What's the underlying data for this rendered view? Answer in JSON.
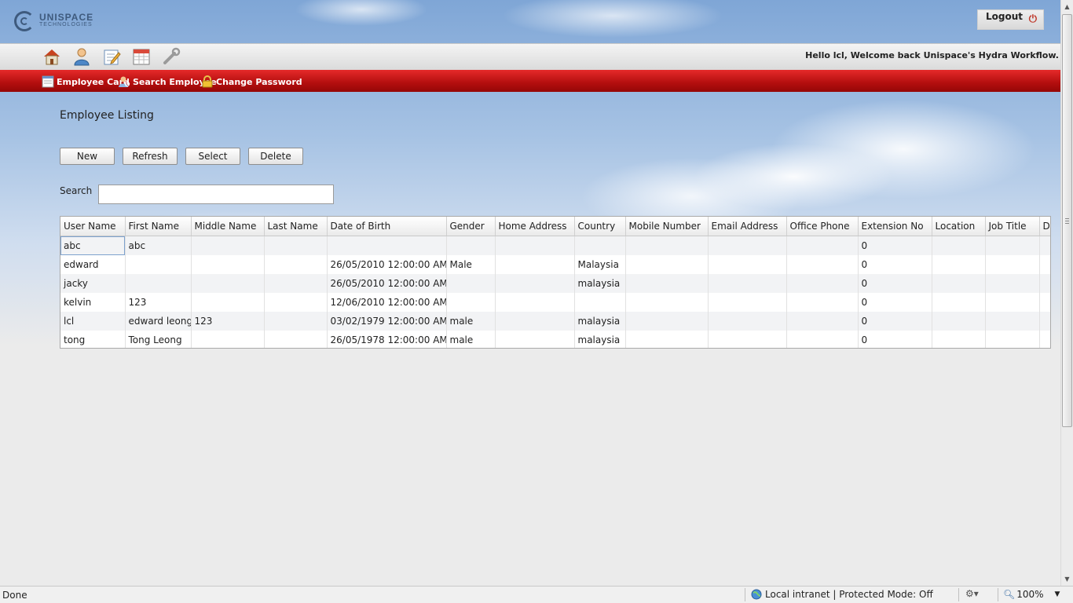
{
  "header": {
    "logo_line1": "UNISPACE",
    "logo_line2": "TECHNOLOGIES",
    "logout_label": "Logout",
    "welcome": "Hello lcl, Welcome back Unispace's Hydra Workflow."
  },
  "toolbar": {
    "icons": [
      "home-icon",
      "user-icon",
      "edit-icon",
      "calendar-icon",
      "tools-icon"
    ]
  },
  "menu": {
    "employee_card": "Employee Card",
    "search_employee": "Search Employee",
    "change_password": "Change Password"
  },
  "page": {
    "title": "Employee Listing",
    "buttons": {
      "new": "New",
      "refresh": "Refresh",
      "select": "Select",
      "delete": "Delete"
    },
    "search_label": "Search",
    "search_value": ""
  },
  "grid": {
    "columns": [
      "User Name",
      "First Name",
      "Middle Name",
      "Last Name",
      "Date of Birth",
      "Gender",
      "Home Address",
      "Country",
      "Mobile Number",
      "Email Address",
      "Office Phone",
      "Extension No",
      "Location",
      "Job Title",
      "De"
    ],
    "rows": [
      [
        "abc",
        "abc",
        "",
        "",
        "",
        "",
        "",
        "",
        "",
        "",
        "",
        "0",
        "",
        "",
        ""
      ],
      [
        "edward",
        "",
        "",
        "",
        "26/05/2010 12:00:00 AM",
        "Male",
        "",
        "Malaysia",
        "",
        "",
        "",
        "0",
        "",
        "",
        ""
      ],
      [
        "jacky",
        "",
        "",
        "",
        "26/05/2010 12:00:00 AM",
        "",
        "",
        "malaysia",
        "",
        "",
        "",
        "0",
        "",
        "",
        ""
      ],
      [
        "kelvin",
        "123",
        "",
        "",
        "12/06/2010 12:00:00 AM",
        "",
        "",
        "",
        "",
        "",
        "",
        "0",
        "",
        "",
        ""
      ],
      [
        "lcl",
        "edward leong",
        "123",
        "",
        "03/02/1979 12:00:00 AM",
        "male",
        "",
        "malaysia",
        "",
        "",
        "",
        "0",
        "",
        "",
        ""
      ],
      [
        "tong",
        "Tong Leong",
        "",
        "",
        "26/05/1978 12:00:00 AM",
        "male",
        "",
        "malaysia",
        "",
        "",
        "",
        "0",
        "",
        "",
        ""
      ]
    ]
  },
  "statusbar": {
    "done": "Done",
    "zone": "Local intranet | Protected Mode: Off",
    "zoom": "100%"
  },
  "colors": {
    "menu_red": "#c41414",
    "logo_blue": "#3e5a7d"
  }
}
